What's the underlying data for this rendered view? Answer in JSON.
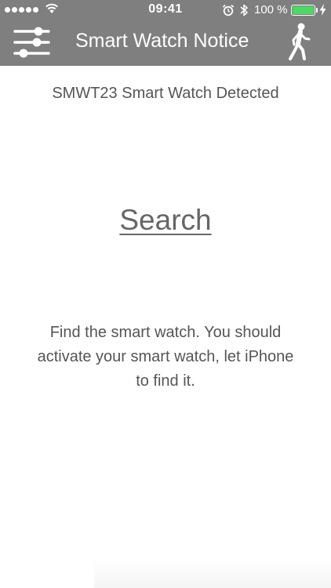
{
  "status_bar": {
    "time": "09:41",
    "battery_percent": "100 %",
    "battery_level": 1.0,
    "signal_bars": 5,
    "icons": [
      "signal-dots",
      "wifi-icon",
      "alarm-icon",
      "bluetooth-icon",
      "battery-icon",
      "charging-icon"
    ]
  },
  "nav": {
    "title": "Smart Watch Notice",
    "left_icon": "sliders-icon",
    "right_icon": "walking-person-icon"
  },
  "main": {
    "detected_text": "SMWT23 Smart Watch Detected",
    "search_label": "Search",
    "instructions": "Find the smart watch. You should activate your smart watch, let iPhone to find it."
  },
  "colors": {
    "header_bg": "#7f7f7f",
    "header_fg": "#ffffff",
    "body_text": "#555555",
    "battery_fill": "#4cd964"
  }
}
